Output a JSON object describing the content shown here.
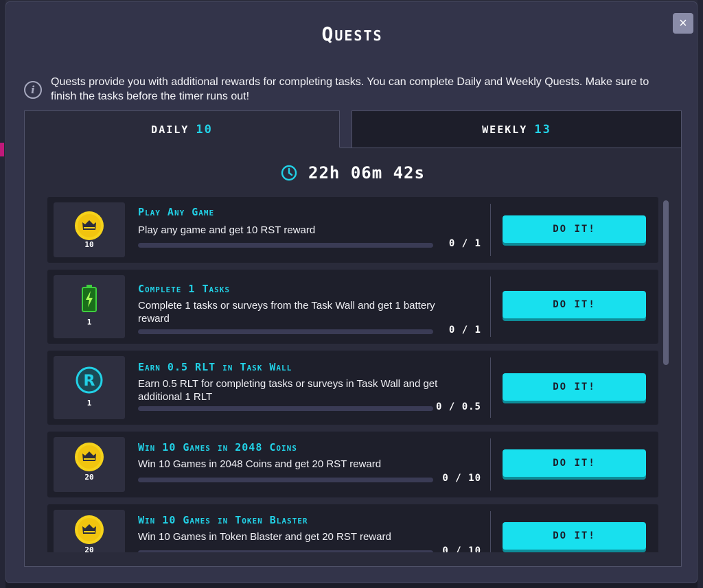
{
  "modal": {
    "title": "Quests",
    "close_label": "×",
    "info_icon": "info-icon",
    "info_text": "Quests provide you with additional rewards for completing tasks. You can complete Daily and Weekly Quests. Make sure to finish the tasks before the timer runs out!"
  },
  "tabs": {
    "daily": {
      "label": "DAILY",
      "count": "10"
    },
    "weekly": {
      "label": "WEEKLY",
      "count": "13"
    }
  },
  "timer": {
    "icon": "clock-icon",
    "value": "22h 06m 42s"
  },
  "quests": [
    {
      "icon": "crown-coin-icon",
      "icon_value": "10",
      "title": "Play Any Game",
      "description": "Play any game and get 10 RST reward",
      "progress": "0 / 1",
      "progress_fraction": 0,
      "button": "DO IT!"
    },
    {
      "icon": "battery-icon",
      "icon_value": "1",
      "title": "Complete 1 Tasks",
      "description": "Complete 1 tasks or surveys from the Task Wall and get 1 battery reward",
      "progress": "0 / 1",
      "progress_fraction": 0,
      "button": "DO IT!"
    },
    {
      "icon": "rlt-coin-icon",
      "icon_value": "1",
      "title": "Earn 0.5 RLT in Task Wall",
      "description": "Earn 0.5 RLT for completing tasks or surveys in Task Wall and get additional 1 RLT",
      "progress": "0 / 0.5",
      "progress_fraction": 0,
      "button": "DO IT!"
    },
    {
      "icon": "crown-coin-icon",
      "icon_value": "20",
      "title": "Win 10 Games in 2048 Coins",
      "description": "Win 10 Games in 2048 Coins and get 20 RST reward",
      "progress": "0 / 10",
      "progress_fraction": 0,
      "button": "DO IT!"
    },
    {
      "icon": "crown-coin-icon",
      "icon_value": "20",
      "title": "Win 10 Games in Token Blaster",
      "description": "Win 10 Games in Token Blaster and get 20 RST reward",
      "progress": "0 / 10",
      "progress_fraction": 0,
      "button": "DO IT!"
    }
  ],
  "colors": {
    "accent": "#22d1e6",
    "button": "#18e0ee",
    "coin": "#f5d21b",
    "battery": "#3fcf3f"
  }
}
